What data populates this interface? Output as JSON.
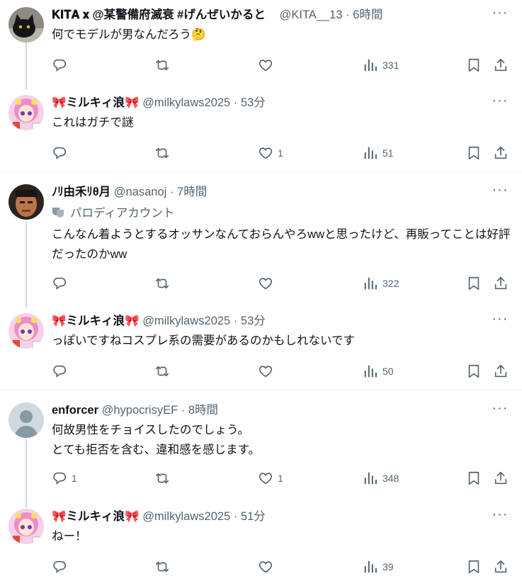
{
  "colors": {
    "text": "#0f1419",
    "secondary": "#536471",
    "thread_line": "#cfd9de",
    "separator": "#eff3f4"
  },
  "posts": [
    {
      "name": "𝐊𝐈𝐓𝐀 𝐱 @某警備府滅衰 #げんぜいかるとㅤ",
      "handle": "@KITA__13",
      "dot": "·",
      "time": "6時間",
      "text": "何でモデルが男なんだろう🤔",
      "reply": "",
      "repost": "",
      "like": "",
      "views": "331",
      "avatar_icon": "black-cat-avatar"
    },
    {
      "name": "🎀ミルキィ浪🎀",
      "handle": "@milkylaws2025",
      "dot": "·",
      "time": "53分",
      "text": "これはガチで謎",
      "reply": "",
      "repost": "",
      "like": "1",
      "views": "51",
      "avatar_icon": "anime-girl-avatar"
    },
    {
      "name": "ﾉﾘ由禾ﾘθ月",
      "handle": "@nasanoj",
      "dot": "·",
      "time": "7時間",
      "parody_label": "パロディアカウント",
      "text": "こんなん着ようとするオッサンなんておらんやろwwと思ったけど、再販ってことは好評だったのかww",
      "reply": "",
      "repost": "",
      "like": "",
      "views": "322",
      "avatar_icon": "man-face-avatar"
    },
    {
      "name": "🎀ミルキィ浪🎀",
      "handle": "@milkylaws2025",
      "dot": "·",
      "time": "53分",
      "text": "っぽいですねコスプレ系の需要があるのかもしれないです",
      "reply": "",
      "repost": "",
      "like": "",
      "views": "50",
      "avatar_icon": "anime-girl-avatar"
    },
    {
      "name": "enforcer",
      "handle": "@hypocrisyEF",
      "dot": "·",
      "time": "8時間",
      "text": "何故男性をチョイスしたのでしょう。\nとても拒否を含む、違和感を感じます。",
      "reply": "1",
      "repost": "",
      "like": "1",
      "views": "348",
      "avatar_icon": "default-person-avatar"
    },
    {
      "name": "🎀ミルキィ浪🎀",
      "handle": "@milkylaws2025",
      "dot": "·",
      "time": "51分",
      "text": "ねー！",
      "reply": "",
      "repost": "",
      "like": "",
      "views": "39",
      "avatar_icon": "anime-girl-avatar"
    }
  ]
}
